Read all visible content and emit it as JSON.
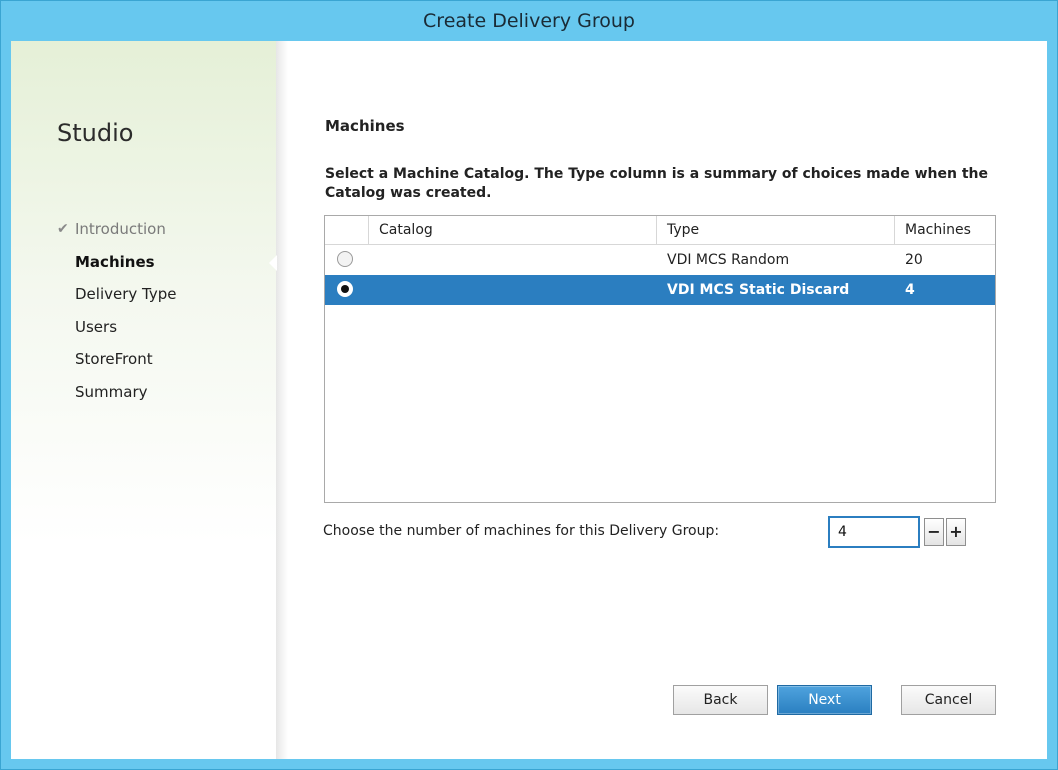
{
  "window": {
    "title": "Create Delivery Group"
  },
  "sidebar": {
    "app_title": "Studio",
    "items": [
      {
        "label": "Introduction",
        "state": "done"
      },
      {
        "label": "Machines",
        "state": "active"
      },
      {
        "label": "Delivery Type",
        "state": "pending"
      },
      {
        "label": "Users",
        "state": "pending"
      },
      {
        "label": "StoreFront",
        "state": "pending"
      },
      {
        "label": "Summary",
        "state": "pending"
      }
    ]
  },
  "main": {
    "section_title": "Machines",
    "instructions": "Select a Machine Catalog. The Type column is a summary of choices made when the Catalog was created.",
    "table": {
      "columns": [
        "Catalog",
        "Type",
        "Machines"
      ],
      "rows": [
        {
          "catalog": "",
          "type": "VDI MCS Random",
          "machines": "20",
          "selected": false
        },
        {
          "catalog": "",
          "type": "VDI MCS Static Discard",
          "machines": "4",
          "selected": true
        }
      ]
    },
    "count_label": "Choose the number of machines for this Delivery Group:",
    "count_value": "4",
    "stepper": {
      "minus": "−",
      "plus": "+"
    }
  },
  "footer": {
    "back_label": "Back",
    "next_label": "Next",
    "cancel_label": "Cancel"
  },
  "colors": {
    "titlebar": "#67c8ef",
    "selection": "#2b7ec0",
    "accent_button": "#2a7fc0"
  }
}
